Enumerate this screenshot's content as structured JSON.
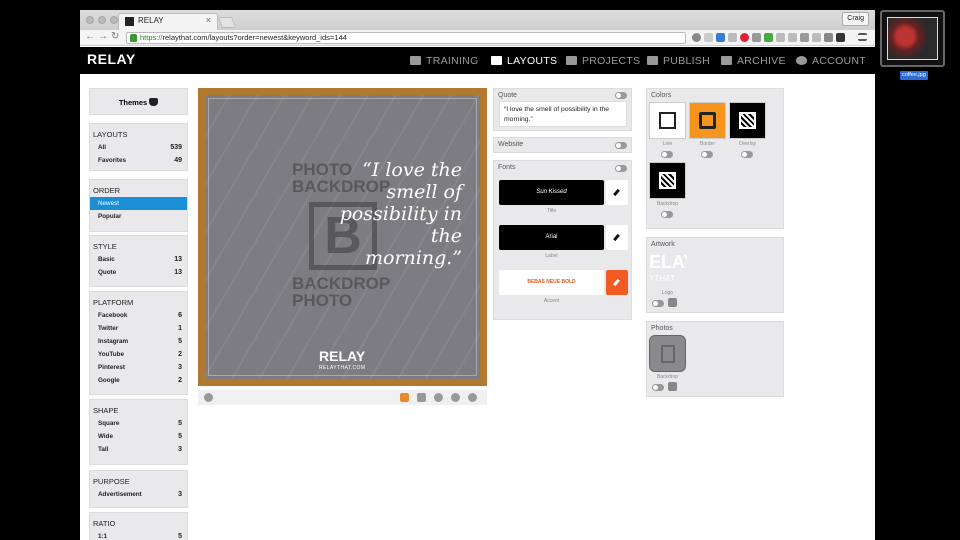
{
  "browser": {
    "tab_title": "RELAY",
    "tab_close": "×",
    "user_button": "Craig",
    "url_secure": "https://",
    "url_rest": "relaythat.com/layouts?order=newest&keyword_ids=144",
    "nav_back": "←",
    "nav_forward": "→",
    "nav_reload": "↻"
  },
  "app": {
    "logo": "RELAY",
    "nav": [
      {
        "label": "TRAINING",
        "active": false
      },
      {
        "label": "LAYOUTS",
        "active": true
      },
      {
        "label": "PROJECTS",
        "active": false
      },
      {
        "label": "PUBLISH",
        "active": false
      },
      {
        "label": "ARCHIVE",
        "active": false
      },
      {
        "label": "ACCOUNT",
        "active": false
      }
    ]
  },
  "sidebar": {
    "themes_label": "Themes",
    "layouts": {
      "title": "LAYOUTS",
      "items": [
        {
          "label": "All",
          "count": "539"
        },
        {
          "label": "Favorites",
          "count": "49"
        }
      ]
    },
    "order": {
      "title": "ORDER",
      "items": [
        {
          "label": "Newest",
          "selected": true
        },
        {
          "label": "Popular",
          "selected": false
        }
      ]
    },
    "style": {
      "title": "STYLE",
      "items": [
        {
          "label": "Basic",
          "count": "13"
        },
        {
          "label": "Quote",
          "count": "13"
        }
      ]
    },
    "platform": {
      "title": "PLATFORM",
      "items": [
        {
          "label": "Facebook",
          "count": "6"
        },
        {
          "label": "Twitter",
          "count": "1"
        },
        {
          "label": "Instagram",
          "count": "5"
        },
        {
          "label": "YouTube",
          "count": "2"
        },
        {
          "label": "Pinterest",
          "count": "3"
        },
        {
          "label": "Google",
          "count": "2"
        }
      ]
    },
    "shape": {
      "title": "SHAPE",
      "items": [
        {
          "label": "Square",
          "count": "5"
        },
        {
          "label": "Wide",
          "count": "5"
        },
        {
          "label": "Tall",
          "count": "3"
        }
      ]
    },
    "purpose": {
      "title": "PURPOSE",
      "items": [
        {
          "label": "Advertisement",
          "count": "3"
        }
      ]
    },
    "ratio": {
      "title": "RATIO",
      "items": [
        {
          "label": "1:1",
          "count": "5"
        }
      ]
    }
  },
  "canvas": {
    "watermark_top": "PHOTO BACKDROP",
    "watermark_letter": "B",
    "watermark_bottom": "BACKDROP PHOTO",
    "quote": "“I love the smell of possibility in the morning.”",
    "brand": "RELAY",
    "brand_sub": "RELAYTHAT.COM",
    "frame_color": "#b0792f",
    "background_color": "#7d7c80"
  },
  "panels": {
    "quote": {
      "title": "Quote",
      "text": "“I love the smell of possibility in the morning.”"
    },
    "website": {
      "title": "Website"
    },
    "fonts": {
      "title": "Fonts",
      "items": [
        {
          "font": "Sun Kissed",
          "label": "Title"
        },
        {
          "font": "Arial",
          "label": "Label"
        },
        {
          "font": "BEBAS NEUE BOLD",
          "label": "Accent"
        }
      ]
    },
    "colors": {
      "title": "Colors",
      "swatches": [
        {
          "label": "Line",
          "color": "#ffffff"
        },
        {
          "label": "Border",
          "color": "#f7941d"
        },
        {
          "label": "Overlay",
          "color": "#000000"
        },
        {
          "label": "Backdrop",
          "color": "#000000"
        }
      ]
    },
    "artwork": {
      "title": "Artwork",
      "item_label": "Logo",
      "logo_text": "ELAY",
      "logo_sub": "YTHAT"
    },
    "photos": {
      "title": "Photos",
      "item_label": "Backdrop"
    }
  },
  "desktop": {
    "thumb_label": "coffee.jpg"
  }
}
